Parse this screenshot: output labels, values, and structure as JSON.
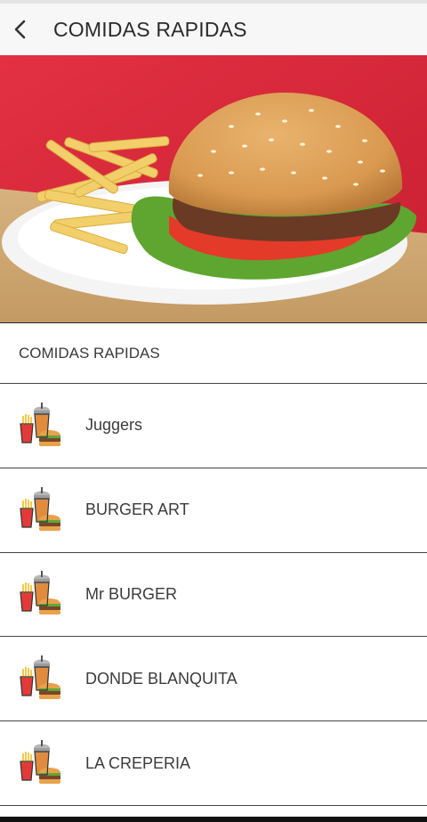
{
  "app_bar": {
    "title": "COMIDAS RAPIDAS",
    "back_icon": "chevron-left-icon"
  },
  "hero": {
    "image": "burger-and-fries-photo"
  },
  "section": {
    "header": "COMIDAS RAPIDAS"
  },
  "restaurants": [
    {
      "name": "Juggers",
      "icon": "fast-food-icon"
    },
    {
      "name": "BURGER ART",
      "icon": "fast-food-icon"
    },
    {
      "name": "Mr BURGER",
      "icon": "fast-food-icon"
    },
    {
      "name": "DONDE BLANQUITA",
      "icon": "fast-food-icon"
    },
    {
      "name": "LA CREPERIA",
      "icon": "fast-food-icon"
    }
  ],
  "colors": {
    "hero_background": "#d9293a",
    "app_bar": "#f7f7f7",
    "divider": "#444444"
  }
}
